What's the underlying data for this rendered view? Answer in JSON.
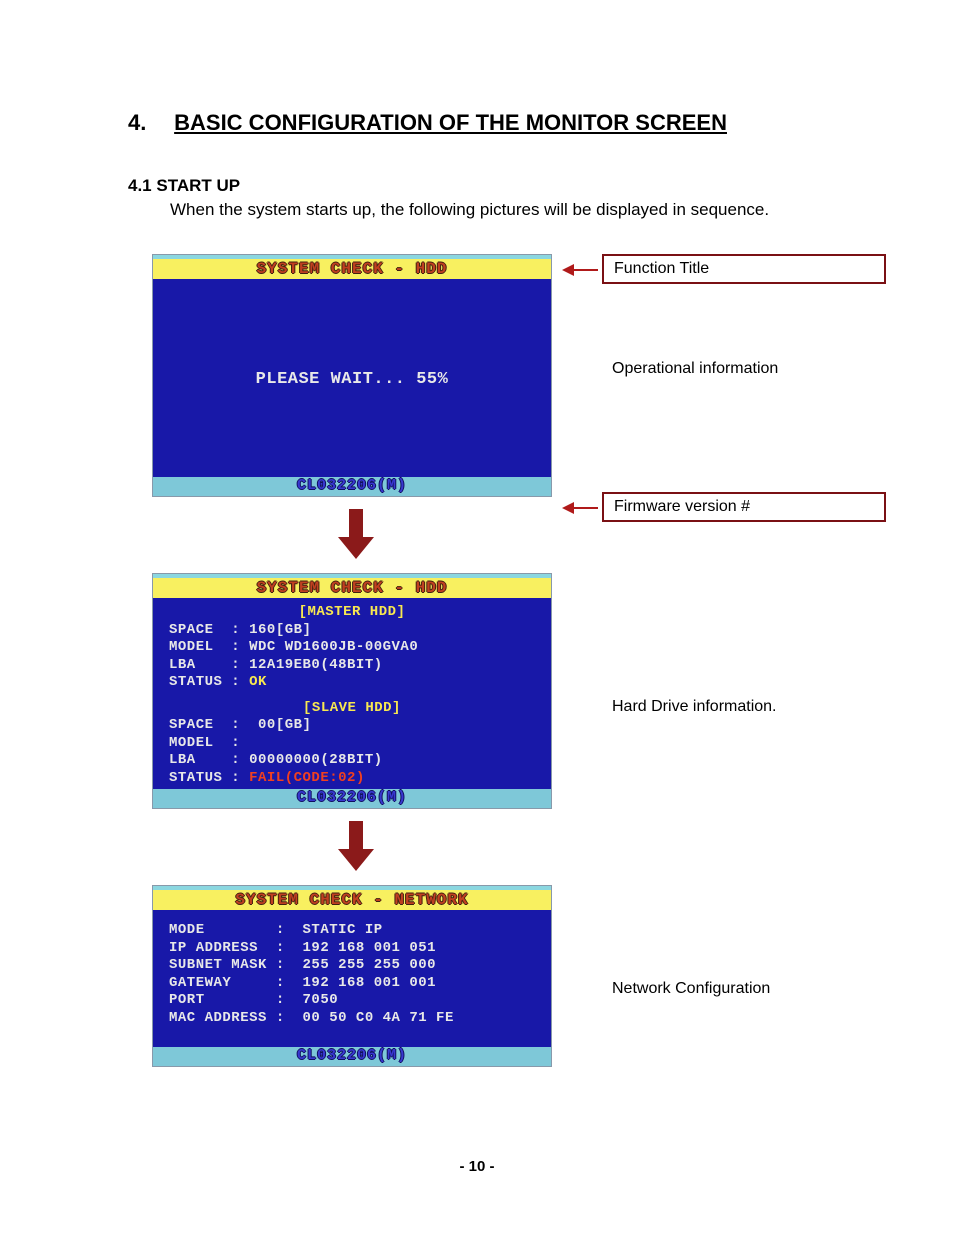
{
  "heading": {
    "number": "4.",
    "title": "BASIC CONFIGURATION OF THE MONITOR SCREEN"
  },
  "section": {
    "number": "4.1",
    "title": "START UP",
    "intro": "When the system starts up, the following pictures will be displayed in sequence."
  },
  "screens": {
    "s1": {
      "title": "SYSTEM CHECK - HDD",
      "wait": "PLEASE WAIT... 55%",
      "fw": "CL032206(M)"
    },
    "s2": {
      "title": "SYSTEM CHECK - HDD",
      "master_h": "[MASTER HDD]",
      "master_space": "SPACE  : 160[GB]",
      "master_model": "MODEL  : WDC WD1600JB-00GVA0",
      "master_lba": "LBA    : 12A19EB0(48BIT)",
      "master_status_l": "STATUS : ",
      "master_status_v": "OK",
      "slave_h": "[SLAVE HDD]",
      "slave_space": "SPACE  :  00[GB]",
      "slave_model": "MODEL  :",
      "slave_lba": "LBA    : 00000000(28BIT)",
      "slave_status_l": "STATUS : ",
      "slave_status_v": "FAIL(CODE:02)",
      "fw": "CL032206(M)"
    },
    "s3": {
      "title": "SYSTEM CHECK - NETWORK",
      "mode": "MODE        :  STATIC IP",
      "ip": "IP ADDRESS  :  192 168 001 051",
      "mask": "SUBNET MASK :  255 255 255 000",
      "gw": "GATEWAY     :  192 168 001 001",
      "port": "PORT        :  7050",
      "mac": "MAC ADDRESS :  00 50 C0 4A 71 FE",
      "fw": "CL032206(M)"
    }
  },
  "callouts": {
    "c1": "Function Title",
    "c2": "Operational information",
    "c3": "Firmware version #",
    "c4": "Hard Drive information.",
    "c5": "Network Configuration"
  },
  "page_number": "- 10 -"
}
